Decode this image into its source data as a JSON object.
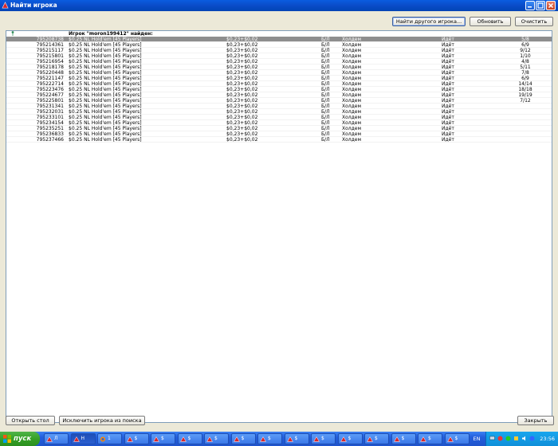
{
  "window": {
    "title": "Найти игрока"
  },
  "toolbar": {
    "find_other": "Найти другого игрока...",
    "refresh": "Обновить",
    "clear": "Очистить"
  },
  "list": {
    "header": "Игрок \"moron199412\" найден:",
    "rows": [
      {
        "id": "795208738",
        "name": "$0.25 NL Hold'em [45 Players]",
        "stakes": "$0,23+$0,02",
        "limit": "Б/Л",
        "game": "Холдем",
        "status": "Идёт",
        "seats": "5/8"
      },
      {
        "id": "795214361",
        "name": "$0.25 NL Hold'em [45 Players]",
        "stakes": "$0,23+$0,02",
        "limit": "Б/Л",
        "game": "Холдем",
        "status": "Идёт",
        "seats": "6/9"
      },
      {
        "id": "795215117",
        "name": "$0.25 NL Hold'em [45 Players]",
        "stakes": "$0,23+$0,02",
        "limit": "Б/Л",
        "game": "Холдем",
        "status": "Идёт",
        "seats": "9/12"
      },
      {
        "id": "795215801",
        "name": "$0.25 NL Hold'em [45 Players]",
        "stakes": "$0,23+$0,02",
        "limit": "Б/Л",
        "game": "Холдем",
        "status": "Идёт",
        "seats": "1/10"
      },
      {
        "id": "795216954",
        "name": "$0.25 NL Hold'em [45 Players]",
        "stakes": "$0,23+$0,02",
        "limit": "Б/Л",
        "game": "Холдем",
        "status": "Идёт",
        "seats": "4/8"
      },
      {
        "id": "795218178",
        "name": "$0.25 NL Hold'em [45 Players]",
        "stakes": "$0,23+$0,02",
        "limit": "Б/Л",
        "game": "Холдем",
        "status": "Идёт",
        "seats": "5/11"
      },
      {
        "id": "795220448",
        "name": "$0.25 NL Hold'em [45 Players]",
        "stakes": "$0,23+$0,02",
        "limit": "Б/Л",
        "game": "Холдем",
        "status": "Идёт",
        "seats": "7/8"
      },
      {
        "id": "795221147",
        "name": "$0.25 NL Hold'em [45 Players]",
        "stakes": "$0,23+$0,02",
        "limit": "Б/Л",
        "game": "Холдем",
        "status": "Идёт",
        "seats": "6/9"
      },
      {
        "id": "795222714",
        "name": "$0.25 NL Hold'em [45 Players]",
        "stakes": "$0,23+$0,02",
        "limit": "Б/Л",
        "game": "Холдем",
        "status": "Идёт",
        "seats": "14/14"
      },
      {
        "id": "795223476",
        "name": "$0.25 NL Hold'em [45 Players]",
        "stakes": "$0,23+$0,02",
        "limit": "Б/Л",
        "game": "Холдем",
        "status": "Идёт",
        "seats": "18/18"
      },
      {
        "id": "795224677",
        "name": "$0.25 NL Hold'em [45 Players]",
        "stakes": "$0,23+$0,02",
        "limit": "Б/Л",
        "game": "Холдем",
        "status": "Идёт",
        "seats": "19/19"
      },
      {
        "id": "795225801",
        "name": "$0.25 NL Hold'em [45 Players]",
        "stakes": "$0,23+$0,02",
        "limit": "Б/Л",
        "game": "Холдем",
        "status": "Идёт",
        "seats": "7/12"
      },
      {
        "id": "795231341",
        "name": "$0.25 NL Hold'em [45 Players]",
        "stakes": "$0,23+$0,02",
        "limit": "Б/Л",
        "game": "Холдем",
        "status": "Идёт",
        "seats": ""
      },
      {
        "id": "795232031",
        "name": "$0.25 NL Hold'em [45 Players]",
        "stakes": "$0,23+$0,02",
        "limit": "Б/Л",
        "game": "Холдем",
        "status": "Идёт",
        "seats": ""
      },
      {
        "id": "795233101",
        "name": "$0.25 NL Hold'em [45 Players]",
        "stakes": "$0,23+$0,02",
        "limit": "Б/Л",
        "game": "Холдем",
        "status": "Идёт",
        "seats": ""
      },
      {
        "id": "795234154",
        "name": "$0.25 NL Hold'em [45 Players]",
        "stakes": "$0,23+$0,02",
        "limit": "Б/Л",
        "game": "Холдем",
        "status": "Идёт",
        "seats": ""
      },
      {
        "id": "795235251",
        "name": "$0.25 NL Hold'em [45 Players]",
        "stakes": "$0,23+$0,02",
        "limit": "Б/Л",
        "game": "Холдем",
        "status": "Идёт",
        "seats": ""
      },
      {
        "id": "795236833",
        "name": "$0.25 NL Hold'em [45 Players]",
        "stakes": "$0,23+$0,02",
        "limit": "Б/Л",
        "game": "Холдем",
        "status": "Идёт",
        "seats": ""
      },
      {
        "id": "795237466",
        "name": "$0.25 NL Hold'em [45 Players]",
        "stakes": "$0,23+$0,02",
        "limit": "Б/Л",
        "game": "Холдем",
        "status": "Идёт",
        "seats": ""
      }
    ]
  },
  "footer": {
    "open_table": "Открыть стол",
    "exclude_player": "Исключить игрока из поиска",
    "close": "Закрыть"
  },
  "taskbar": {
    "start_label": "пуск",
    "tasks": [
      {
        "label": "Л",
        "icon": "poker-icon",
        "active": false
      },
      {
        "label": "Н",
        "icon": "poker-icon",
        "active": true
      },
      {
        "label": "1",
        "icon": "browser-icon",
        "active": false
      },
      {
        "label": "$",
        "icon": "poker-icon",
        "active": false
      },
      {
        "label": "$",
        "icon": "poker-icon",
        "active": false
      },
      {
        "label": "$",
        "icon": "poker-icon",
        "active": false
      },
      {
        "label": "$",
        "icon": "poker-icon",
        "active": false
      },
      {
        "label": "$",
        "icon": "poker-icon",
        "active": false
      },
      {
        "label": "$",
        "icon": "poker-icon",
        "active": false
      },
      {
        "label": "$",
        "icon": "poker-icon",
        "active": false
      },
      {
        "label": "$",
        "icon": "poker-icon",
        "active": false
      },
      {
        "label": "$",
        "icon": "poker-icon",
        "active": false
      },
      {
        "label": "$",
        "icon": "poker-icon",
        "active": false
      },
      {
        "label": "$",
        "icon": "poker-icon",
        "active": false
      },
      {
        "label": "$",
        "icon": "poker-icon",
        "active": false
      },
      {
        "label": "$",
        "icon": "poker-icon",
        "active": false
      }
    ],
    "language": "EN",
    "clock": "23:56"
  },
  "colors": {
    "selected_row": "#8e8e8e",
    "titlebar": "#0a4cc8",
    "taskbar": "#245edb",
    "start_button": "#35a026"
  }
}
